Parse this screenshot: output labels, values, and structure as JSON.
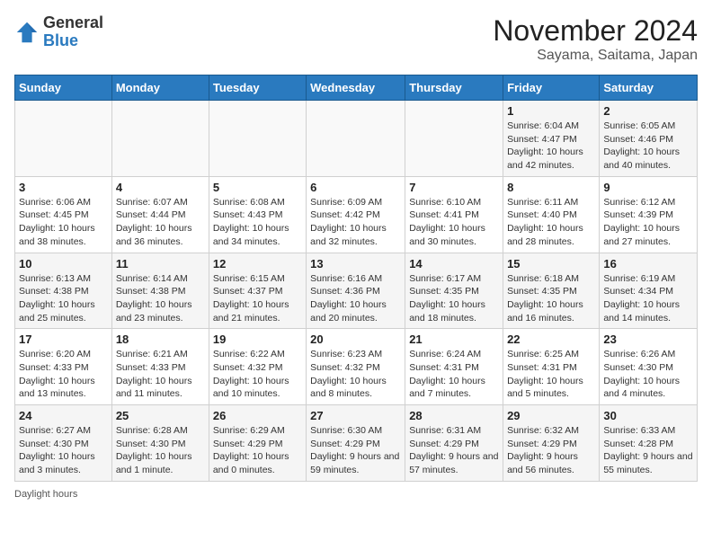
{
  "header": {
    "logo_general": "General",
    "logo_blue": "Blue",
    "title": "November 2024",
    "subtitle": "Sayama, Saitama, Japan"
  },
  "calendar": {
    "days_of_week": [
      "Sunday",
      "Monday",
      "Tuesday",
      "Wednesday",
      "Thursday",
      "Friday",
      "Saturday"
    ],
    "weeks": [
      [
        {
          "day": "",
          "info": ""
        },
        {
          "day": "",
          "info": ""
        },
        {
          "day": "",
          "info": ""
        },
        {
          "day": "",
          "info": ""
        },
        {
          "day": "",
          "info": ""
        },
        {
          "day": "1",
          "info": "Sunrise: 6:04 AM\nSunset: 4:47 PM\nDaylight: 10 hours and 42 minutes."
        },
        {
          "day": "2",
          "info": "Sunrise: 6:05 AM\nSunset: 4:46 PM\nDaylight: 10 hours and 40 minutes."
        }
      ],
      [
        {
          "day": "3",
          "info": "Sunrise: 6:06 AM\nSunset: 4:45 PM\nDaylight: 10 hours and 38 minutes."
        },
        {
          "day": "4",
          "info": "Sunrise: 6:07 AM\nSunset: 4:44 PM\nDaylight: 10 hours and 36 minutes."
        },
        {
          "day": "5",
          "info": "Sunrise: 6:08 AM\nSunset: 4:43 PM\nDaylight: 10 hours and 34 minutes."
        },
        {
          "day": "6",
          "info": "Sunrise: 6:09 AM\nSunset: 4:42 PM\nDaylight: 10 hours and 32 minutes."
        },
        {
          "day": "7",
          "info": "Sunrise: 6:10 AM\nSunset: 4:41 PM\nDaylight: 10 hours and 30 minutes."
        },
        {
          "day": "8",
          "info": "Sunrise: 6:11 AM\nSunset: 4:40 PM\nDaylight: 10 hours and 28 minutes."
        },
        {
          "day": "9",
          "info": "Sunrise: 6:12 AM\nSunset: 4:39 PM\nDaylight: 10 hours and 27 minutes."
        }
      ],
      [
        {
          "day": "10",
          "info": "Sunrise: 6:13 AM\nSunset: 4:38 PM\nDaylight: 10 hours and 25 minutes."
        },
        {
          "day": "11",
          "info": "Sunrise: 6:14 AM\nSunset: 4:38 PM\nDaylight: 10 hours and 23 minutes."
        },
        {
          "day": "12",
          "info": "Sunrise: 6:15 AM\nSunset: 4:37 PM\nDaylight: 10 hours and 21 minutes."
        },
        {
          "day": "13",
          "info": "Sunrise: 6:16 AM\nSunset: 4:36 PM\nDaylight: 10 hours and 20 minutes."
        },
        {
          "day": "14",
          "info": "Sunrise: 6:17 AM\nSunset: 4:35 PM\nDaylight: 10 hours and 18 minutes."
        },
        {
          "day": "15",
          "info": "Sunrise: 6:18 AM\nSunset: 4:35 PM\nDaylight: 10 hours and 16 minutes."
        },
        {
          "day": "16",
          "info": "Sunrise: 6:19 AM\nSunset: 4:34 PM\nDaylight: 10 hours and 14 minutes."
        }
      ],
      [
        {
          "day": "17",
          "info": "Sunrise: 6:20 AM\nSunset: 4:33 PM\nDaylight: 10 hours and 13 minutes."
        },
        {
          "day": "18",
          "info": "Sunrise: 6:21 AM\nSunset: 4:33 PM\nDaylight: 10 hours and 11 minutes."
        },
        {
          "day": "19",
          "info": "Sunrise: 6:22 AM\nSunset: 4:32 PM\nDaylight: 10 hours and 10 minutes."
        },
        {
          "day": "20",
          "info": "Sunrise: 6:23 AM\nSunset: 4:32 PM\nDaylight: 10 hours and 8 minutes."
        },
        {
          "day": "21",
          "info": "Sunrise: 6:24 AM\nSunset: 4:31 PM\nDaylight: 10 hours and 7 minutes."
        },
        {
          "day": "22",
          "info": "Sunrise: 6:25 AM\nSunset: 4:31 PM\nDaylight: 10 hours and 5 minutes."
        },
        {
          "day": "23",
          "info": "Sunrise: 6:26 AM\nSunset: 4:30 PM\nDaylight: 10 hours and 4 minutes."
        }
      ],
      [
        {
          "day": "24",
          "info": "Sunrise: 6:27 AM\nSunset: 4:30 PM\nDaylight: 10 hours and 3 minutes."
        },
        {
          "day": "25",
          "info": "Sunrise: 6:28 AM\nSunset: 4:30 PM\nDaylight: 10 hours and 1 minute."
        },
        {
          "day": "26",
          "info": "Sunrise: 6:29 AM\nSunset: 4:29 PM\nDaylight: 10 hours and 0 minutes."
        },
        {
          "day": "27",
          "info": "Sunrise: 6:30 AM\nSunset: 4:29 PM\nDaylight: 9 hours and 59 minutes."
        },
        {
          "day": "28",
          "info": "Sunrise: 6:31 AM\nSunset: 4:29 PM\nDaylight: 9 hours and 57 minutes."
        },
        {
          "day": "29",
          "info": "Sunrise: 6:32 AM\nSunset: 4:29 PM\nDaylight: 9 hours and 56 minutes."
        },
        {
          "day": "30",
          "info": "Sunrise: 6:33 AM\nSunset: 4:28 PM\nDaylight: 9 hours and 55 minutes."
        }
      ]
    ]
  },
  "footer": {
    "daylight_label": "Daylight hours"
  }
}
